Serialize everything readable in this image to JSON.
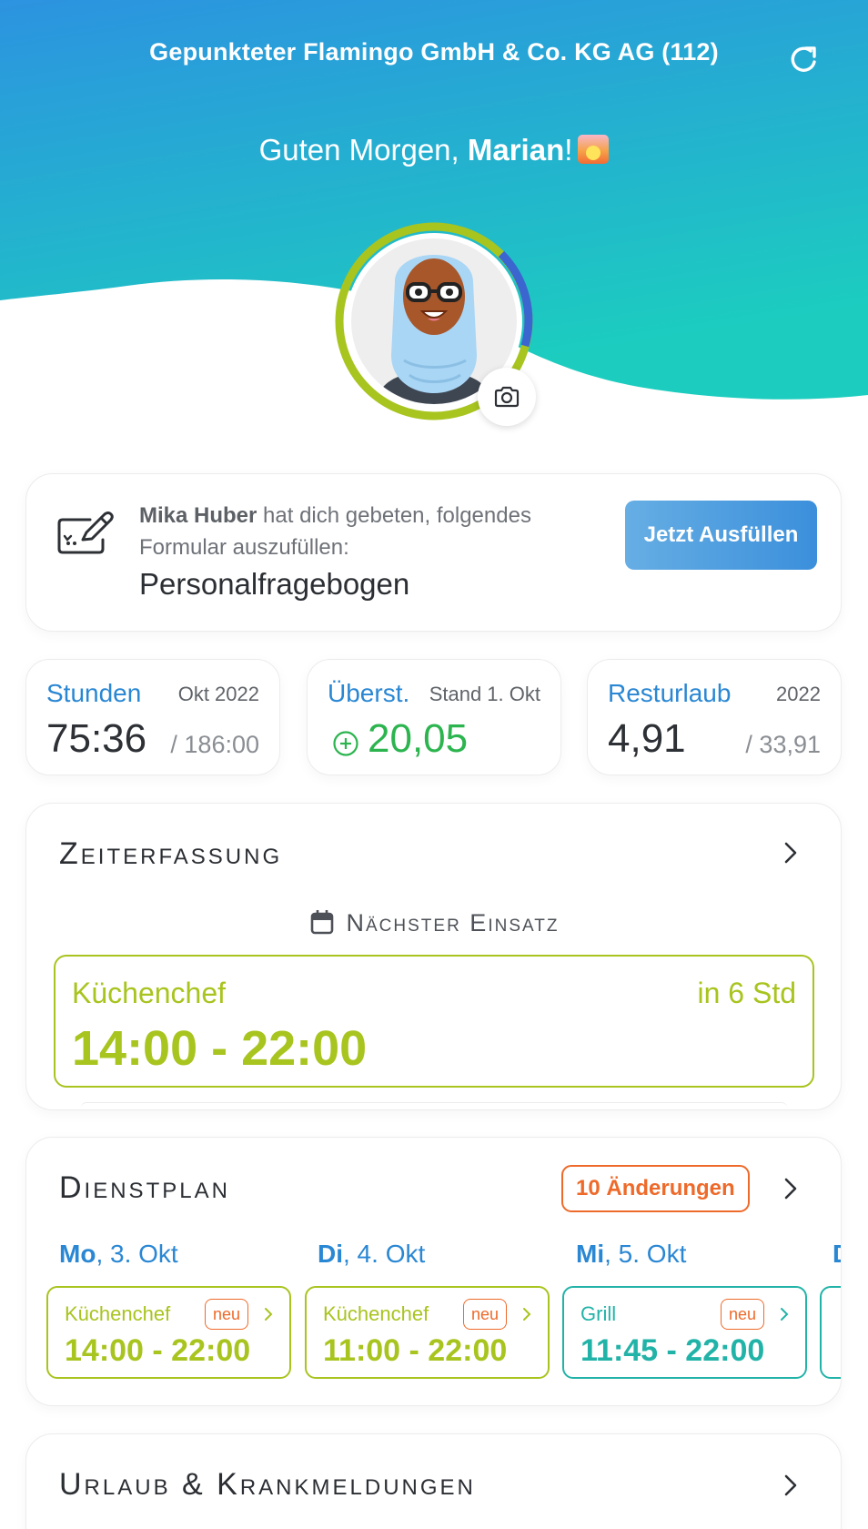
{
  "header": {
    "company": "Gepunkteter Flamingo GmbH & Co. KG AG (112)",
    "greeting_prefix": "Guten Morgen, ",
    "greeting_name": "Marian",
    "greeting_suffix": "!",
    "gradient_top": "#2c93e0",
    "gradient_bottom": "#1ccdbf"
  },
  "form_request": {
    "requester": "Mika Huber",
    "message_rest": " hat dich gebeten, folgendes Formular auszufüllen:",
    "form_name": "Personalfragebogen",
    "button_label": "Jetzt Ausfüllen"
  },
  "stats": {
    "hours": {
      "title": "Stunden",
      "period": "Okt 2022",
      "value": "75:36",
      "total": "/ 186:00"
    },
    "overtime": {
      "title": "Überst.",
      "period": "Stand 1. Okt",
      "value": "20,05"
    },
    "vacation": {
      "title": "Resturlaub",
      "period": "2022",
      "value": "4,91",
      "total": "/ 33,91"
    }
  },
  "time_tracking": {
    "title": "Zeiterfassung",
    "next_label": "Nächster Einsatz",
    "next_shift": {
      "role": "Küchenchef",
      "relative": "in 6 Std",
      "time": "14:00 - 22:00"
    }
  },
  "schedule": {
    "title": "Dienstplan",
    "changes_badge": "10 Änderungen",
    "days": [
      {
        "weekday": "Mo",
        "date": ", 3. Okt",
        "role": "Küchenchef",
        "tag": "neu",
        "time": "14:00 - 22:00",
        "color": "#a8c41f"
      },
      {
        "weekday": "Di",
        "date": ", 4. Okt",
        "role": "Küchenchef",
        "tag": "neu",
        "time": "11:00 - 22:00",
        "color": "#a8c41f"
      },
      {
        "weekday": "Mi",
        "date": ", 5. Okt",
        "role": "Grill",
        "tag": "neu",
        "time": "11:45 - 22:00",
        "color": "#22b3a8"
      },
      {
        "weekday": "D",
        "date": "",
        "role": "",
        "tag": "",
        "time": "",
        "color": "#22b3a8"
      }
    ]
  },
  "leave": {
    "title": "Urlaub & Krankmeldungen"
  }
}
